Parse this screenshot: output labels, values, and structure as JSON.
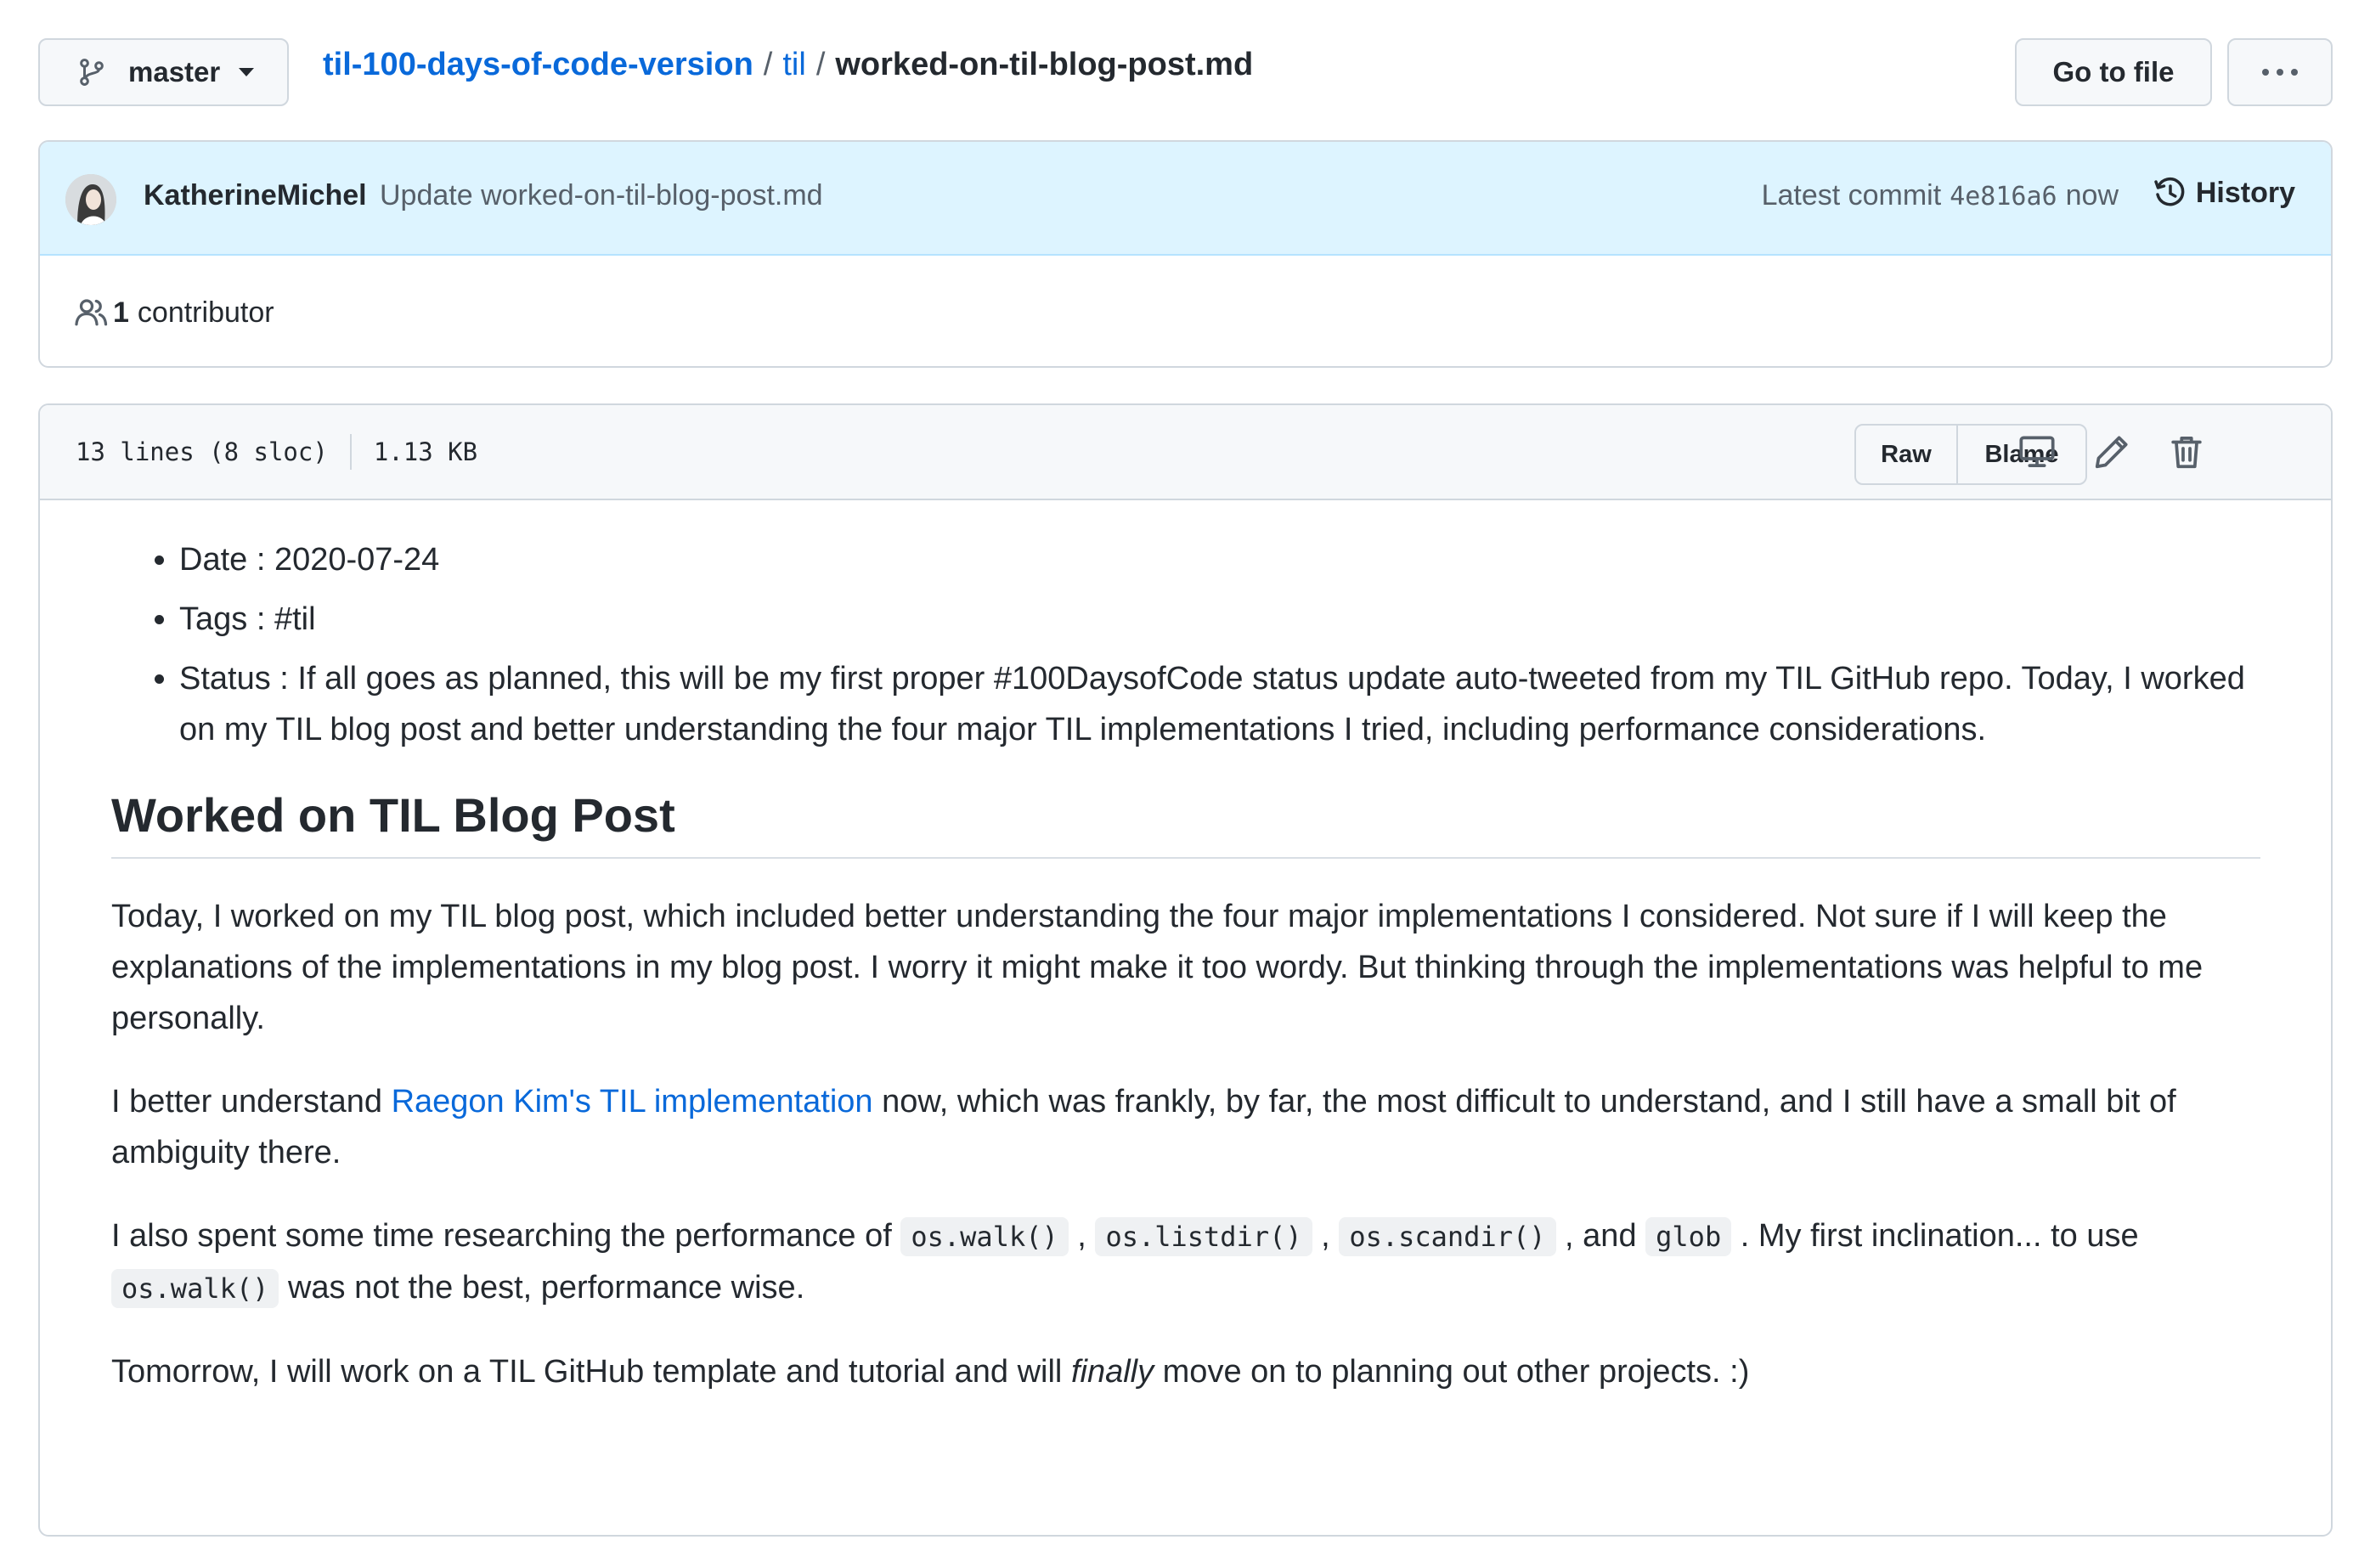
{
  "branch": {
    "name": "master"
  },
  "breadcrumb": {
    "repo": "til-100-days-of-code-version",
    "sep1": "/",
    "folder": "til",
    "sep2": "/",
    "file": "worked-on-til-blog-post.md"
  },
  "actions": {
    "go_to_file": "Go to file"
  },
  "commit": {
    "author": "KatherineMichel",
    "message": "Update worked-on-til-blog-post.md",
    "latest_label": "Latest commit",
    "sha": "4e816a6",
    "time": "now",
    "history_label": "History"
  },
  "contributors": {
    "count": "1",
    "label": "contributor"
  },
  "file": {
    "lines": "13 lines (8 sloc)",
    "size": "1.13 KB",
    "raw_label": "Raw",
    "blame_label": "Blame"
  },
  "content": {
    "list": [
      "Date : 2020-07-24",
      "Tags : #til",
      "Status : If all goes as planned, this will be my first proper #100DaysofCode status update auto-tweeted from my TIL GitHub repo. Today, I worked on my TIL blog post and better understanding the four major TIL implementations I tried, including performance considerations."
    ],
    "heading": "Worked on TIL Blog Post",
    "p1": "Today, I worked on my TIL blog post, which included better understanding the four major implementations I considered. Not sure if I will keep the explanations of the implementations in my blog post. I worry it might make it too wordy. But thinking through the implementations was helpful to me personally.",
    "p2": {
      "before": "I better understand ",
      "link": "Raegon Kim's TIL implementation",
      "after": " now, which was frankly, by far, the most difficult to understand, and I still have a small bit of ambiguity there."
    },
    "p3": {
      "t1": "I also spent some time researching the performance of ",
      "c1": "os.walk()",
      "t2": " , ",
      "c2": "os.listdir()",
      "t3": " , ",
      "c3": "os.scandir()",
      "t4": " , and ",
      "c4": "glob",
      "t5": " . My first inclination... to use ",
      "c5": "os.walk()",
      "t6": " was not the best, performance wise."
    },
    "p4": {
      "before": "Tomorrow, I will work on a TIL GitHub template and tutorial and will ",
      "em": "finally",
      "after": " move on to planning out other projects. :)"
    }
  },
  "colors": {
    "link": "#0969da",
    "commit_bg": "#ddf4ff",
    "header_bg": "#f6f8fa",
    "border": "#d0d7de"
  }
}
